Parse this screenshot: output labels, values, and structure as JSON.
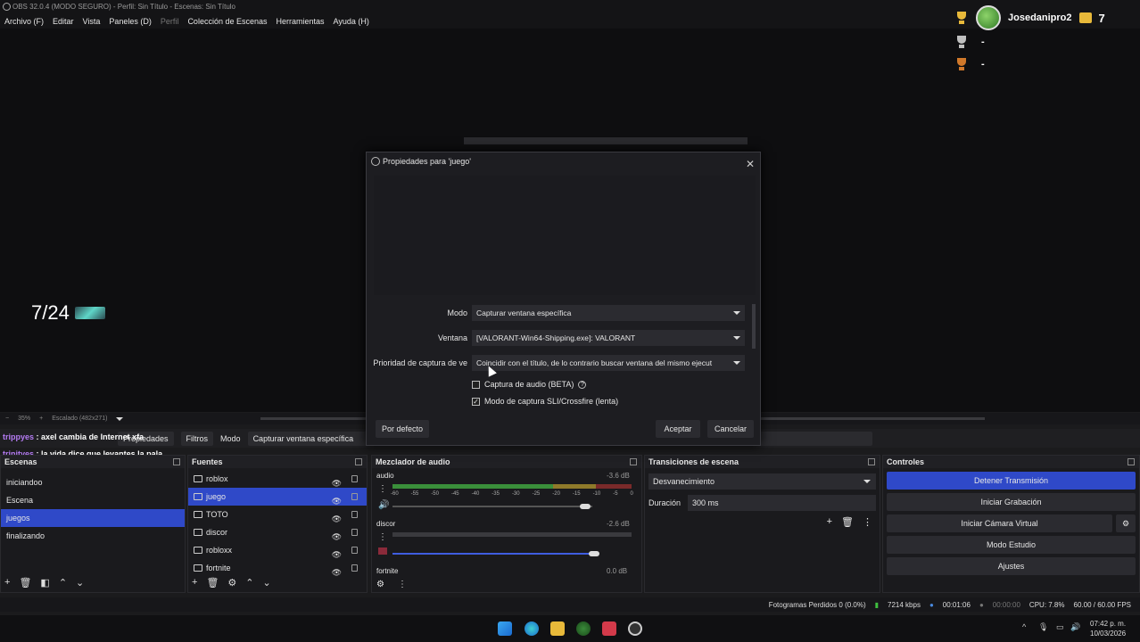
{
  "window": {
    "title": "OBS 32.0.4 (MODO SEGURO) - Perfil: Sin Título - Escenas: Sin Título"
  },
  "menu": {
    "items": [
      "Archivo (F)",
      "Editar",
      "Vista",
      "Paneles (D)",
      "Perfil",
      "Colección de Escenas",
      "Herramientas",
      "Ayuda (H)"
    ]
  },
  "overlay": {
    "username": "Josedanipro2",
    "coins": "7",
    "rank2": "-",
    "rank3": "-",
    "counter": "7/24"
  },
  "zoombar": {
    "zoom_minus": "−",
    "zoom": "35%",
    "zoom_plus": "+",
    "scale": "Escalado (482x271)"
  },
  "sourcebar": {
    "properties": "Propiedades",
    "filters": "Filtros",
    "mode_label": "Modo",
    "mode_value": "Capturar ventana específica"
  },
  "chat": [
    {
      "name": "trippyes",
      "text": ": axel cambia de Internet xfa"
    },
    {
      "name": "trinityes",
      "text": ": la vida dice que levantes la pala"
    }
  ],
  "scenes": {
    "title": "Escenas",
    "items": [
      "iniciandoo",
      "Escena",
      "juegos",
      "finalizando"
    ],
    "selected": 2
  },
  "sources": {
    "title": "Fuentes",
    "items": [
      "roblox",
      "juego",
      "TOTO",
      "discor",
      "robloxx",
      "fortnite"
    ],
    "selected": 1
  },
  "mixer": {
    "title": "Mezclador de audio",
    "channels": [
      {
        "name": "audio",
        "db": "-3.6 dB",
        "level": 0.78
      },
      {
        "name": "discor",
        "db": "-2.6 dB",
        "level": 0.86
      },
      {
        "name": "fortnite",
        "db": "0.0 dB"
      }
    ],
    "scale": [
      "-60",
      "-55",
      "-50",
      "-45",
      "-40",
      "-35",
      "-30",
      "-25",
      "-20",
      "-15",
      "-10",
      "-5",
      "0"
    ]
  },
  "transitions": {
    "title": "Transiciones de escena",
    "selected": "Desvanecimiento",
    "duration_label": "Duración",
    "duration_value": "300 ms"
  },
  "controls": {
    "title": "Controles",
    "buttons": [
      "Detener Transmisión",
      "Iniciar Grabación",
      "Iniciar Cámara Virtual",
      "Modo Estudio",
      "Ajustes"
    ]
  },
  "dialog": {
    "title": "Propiedades para 'juego'",
    "mode_label": "Modo",
    "mode_value": "Capturar ventana específica",
    "window_label": "Ventana",
    "window_value": "[VALORANT-Win64-Shipping.exe]: VALORANT",
    "priority_label": "Prioridad de captura de ve",
    "priority_value": "Coincidir con el título, de lo contrario buscar ventana del mismo ejecut",
    "audio_capture": "Captura de audio (BETA)",
    "sli_mode": "Modo de captura SLI/Crossfire (lenta)",
    "defaults": "Por defecto",
    "accept": "Aceptar",
    "cancel": "Cancelar"
  },
  "status": {
    "dropped": "Fotogramas Perdidos 0 (0.0%)",
    "kbps": "7214 kbps",
    "stream_time": "00:01:06",
    "rec_time": "00:00:00",
    "cpu": "CPU: 7.8%",
    "fps": "60.00 / 60.00 FPS"
  },
  "taskbar": {
    "time": "07:42 p. m.",
    "date": "10/03/2026"
  },
  "colors": {
    "accent": "#2f49c8",
    "gold": "#e8b93a",
    "silver": "#bfbfbf",
    "bronze": "#d0782a"
  }
}
